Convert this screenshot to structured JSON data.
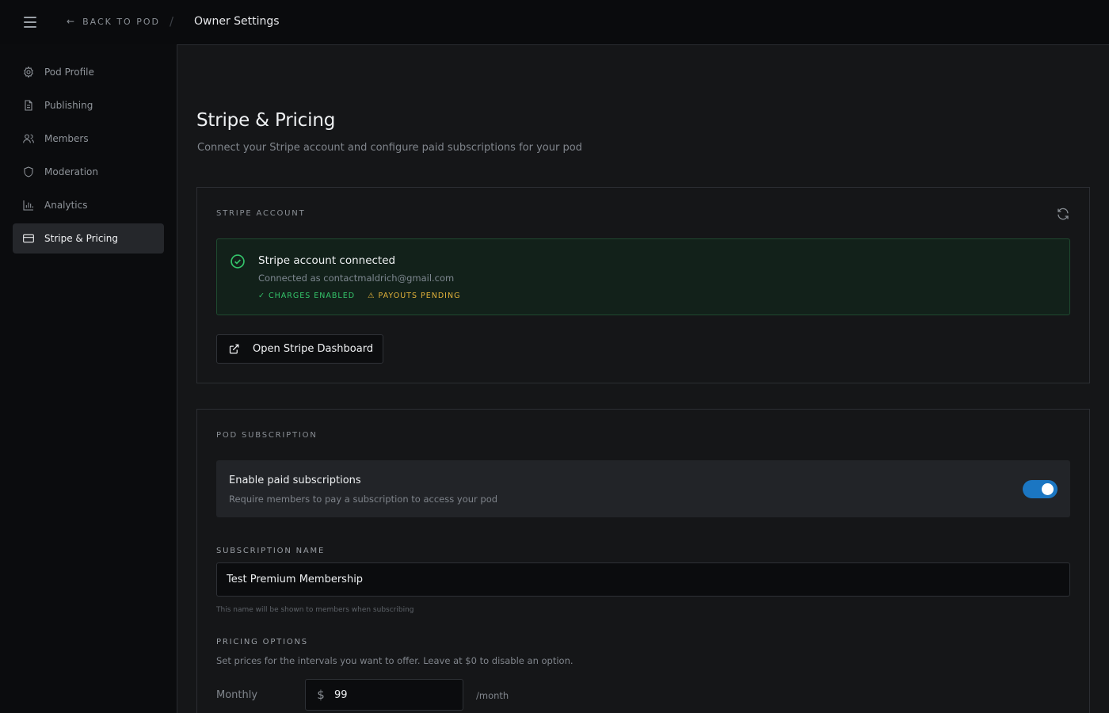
{
  "header": {
    "back_label": "BACK TO POD",
    "separator": "/",
    "current": "Owner Settings"
  },
  "sidebar": {
    "items": [
      {
        "label": "Pod Profile",
        "icon": "gear-icon"
      },
      {
        "label": "Publishing",
        "icon": "document-icon"
      },
      {
        "label": "Members",
        "icon": "users-icon"
      },
      {
        "label": "Moderation",
        "icon": "shield-icon"
      },
      {
        "label": "Analytics",
        "icon": "bar-chart-icon"
      },
      {
        "label": "Stripe & Pricing",
        "icon": "credit-card-icon",
        "active": true
      }
    ]
  },
  "page": {
    "title": "Stripe & Pricing",
    "subtitle": "Connect your Stripe account and configure paid subscriptions for your pod"
  },
  "stripe_account": {
    "section_label": "STRIPE ACCOUNT",
    "status_title": "Stripe account connected",
    "connected_as": "Connected as contactmaldrich@gmail.com",
    "charges_badge": "✓ CHARGES ENABLED",
    "payouts_badge": "⚠ PAYOUTS PENDING",
    "dashboard_button": "Open Stripe Dashboard"
  },
  "pod_subscription": {
    "section_label": "POD SUBSCRIPTION",
    "toggle_title": "Enable paid subscriptions",
    "toggle_desc": "Require members to pay a subscription to access your pod",
    "toggle_on": true,
    "name_label": "SUBSCRIPTION NAME",
    "name_value": "Test Premium Membership",
    "name_hint": "This name will be shown to members when subscribing",
    "pricing_label": "PRICING OPTIONS",
    "pricing_desc": "Set prices for the intervals you want to offer. Leave at $0 to disable an option.",
    "monthly_label": "Monthly",
    "currency_symbol": "$",
    "monthly_value": "99",
    "monthly_unit": "/month"
  },
  "colors": {
    "accent": "#1b76c2",
    "success": "#34c46a",
    "warning": "#e0b13a"
  }
}
